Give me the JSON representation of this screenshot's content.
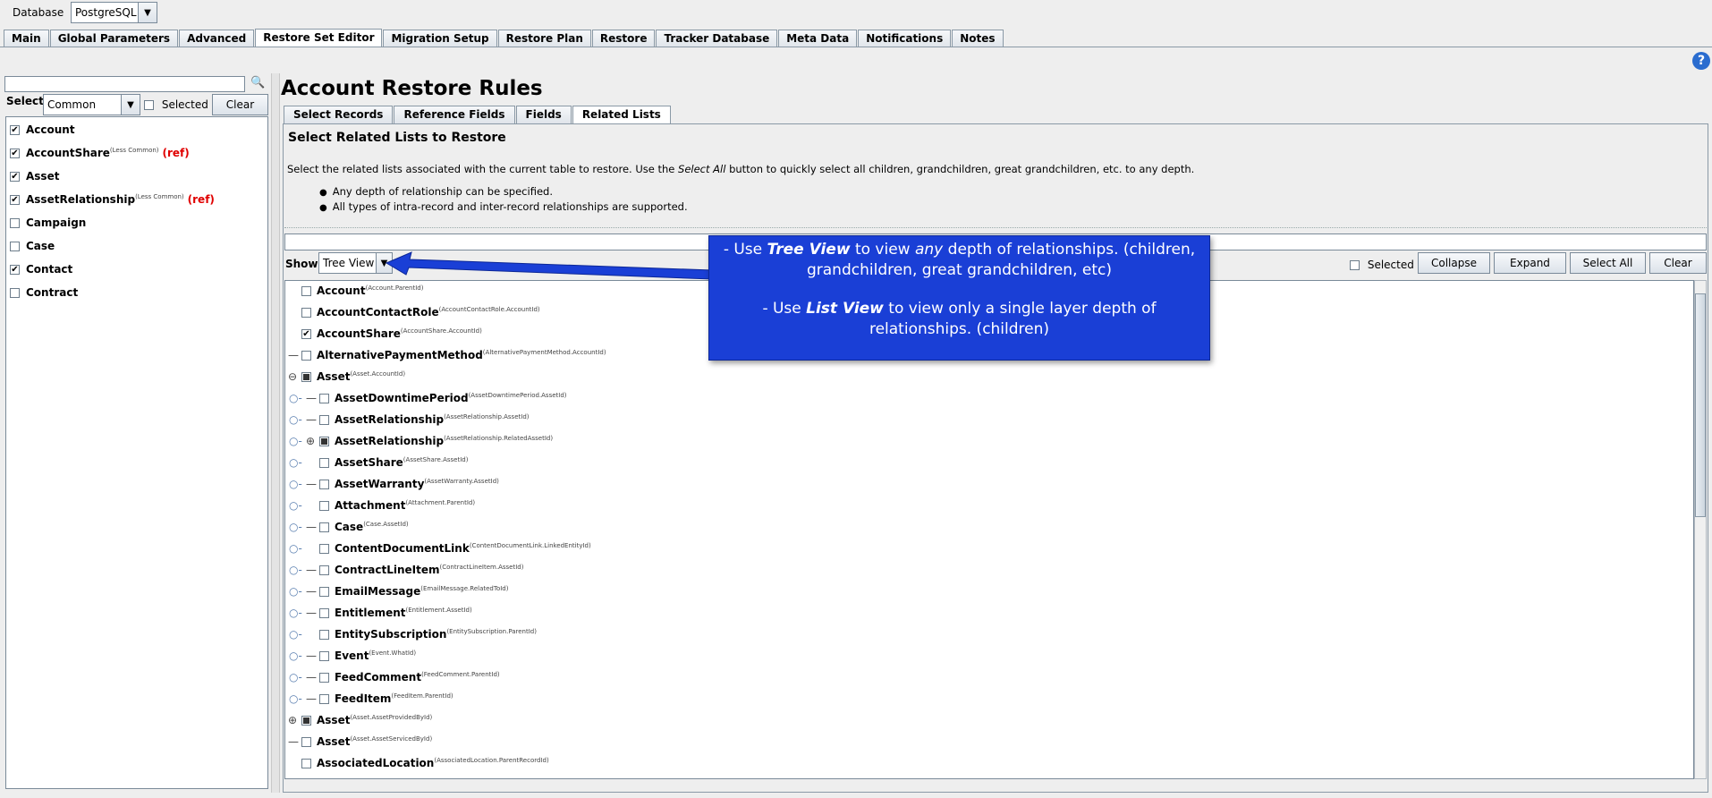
{
  "header": {
    "database_label": "Database",
    "database_value": "PostgreSQL"
  },
  "main_tabs": [
    "Main",
    "Global Parameters",
    "Advanced",
    "Restore Set Editor",
    "Migration Setup",
    "Restore Plan",
    "Restore",
    "Tracker Database",
    "Meta Data",
    "Notifications",
    "Notes"
  ],
  "left": {
    "select_label": "Select:",
    "select_value": "Common",
    "selected_label": "Selected",
    "clear_label": "Clear",
    "items": [
      {
        "label": "Account",
        "sup": "",
        "ref": "",
        "checked": true
      },
      {
        "label": "AccountShare",
        "sup": "(Less Common)",
        "ref": "(ref)",
        "checked": true
      },
      {
        "label": "Asset",
        "sup": "",
        "ref": "",
        "checked": true
      },
      {
        "label": "AssetRelationship",
        "sup": "(Less Common)",
        "ref": "(ref)",
        "checked": true
      },
      {
        "label": "Campaign",
        "sup": "",
        "ref": "",
        "checked": false
      },
      {
        "label": "Case",
        "sup": "",
        "ref": "",
        "checked": false
      },
      {
        "label": "Contact",
        "sup": "",
        "ref": "",
        "checked": true
      },
      {
        "label": "Contract",
        "sup": "",
        "ref": "",
        "checked": false
      }
    ]
  },
  "right": {
    "title": "Account Restore Rules",
    "sub_tabs": [
      "Select Records",
      "Reference Fields",
      "Fields",
      "Related Lists"
    ],
    "heading": "Select Related Lists to Restore",
    "desc_before": "Select the related lists associated with the current table to restore. Use the ",
    "desc_em": "Select All",
    "desc_after": " button to quickly select all children, grandchildren, great grandchildren, etc. to any depth.",
    "bullets": [
      "Any depth of relationship can be specified.",
      "All types of intra-record and inter-record relationships are supported."
    ],
    "show_label": "Show:",
    "show_value": "Tree View",
    "selected_label": "Selected",
    "collapse_label": "Collapse",
    "expand_label": "Expand",
    "select_all_label": "Select All",
    "clear_label": "Clear",
    "tree": [
      {
        "label": "Account",
        "sup": "(Account.ParentId)",
        "depth": 0,
        "state": "unchecked",
        "mark": ""
      },
      {
        "label": "AccountContactRole",
        "sup": "(AccountContactRole.AccountId)",
        "depth": 0,
        "state": "unchecked",
        "mark": ""
      },
      {
        "label": "AccountShare",
        "sup": "(AccountShare.AccountId)",
        "depth": 0,
        "state": "checked",
        "mark": ""
      },
      {
        "label": "AlternativePaymentMethod",
        "sup": "(AlternativePaymentMethod.AccountId)",
        "depth": 0,
        "state": "unchecked",
        "mark": "—"
      },
      {
        "label": "Asset",
        "sup": "(Asset.AccountId)",
        "depth": 0,
        "state": "partial",
        "mark": "⊖"
      },
      {
        "label": "AssetDowntimePeriod",
        "sup": "(AssetDowntimePeriod.AssetId)",
        "depth": 1,
        "state": "unchecked",
        "mark": "—"
      },
      {
        "label": "AssetRelationship",
        "sup": "(AssetRelationship.AssetId)",
        "depth": 1,
        "state": "unchecked",
        "mark": "—"
      },
      {
        "label": "AssetRelationship",
        "sup": "(AssetRelationship.RelatedAssetId)",
        "depth": 1,
        "state": "partial",
        "mark": "⊕"
      },
      {
        "label": "AssetShare",
        "sup": "(AssetShare.AssetId)",
        "depth": 1,
        "state": "unchecked",
        "mark": ""
      },
      {
        "label": "AssetWarranty",
        "sup": "(AssetWarranty.AssetId)",
        "depth": 1,
        "state": "unchecked",
        "mark": "—"
      },
      {
        "label": "Attachment",
        "sup": "(Attachment.ParentId)",
        "depth": 1,
        "state": "unchecked",
        "mark": ""
      },
      {
        "label": "Case",
        "sup": "(Case.AssetId)",
        "depth": 1,
        "state": "unchecked",
        "mark": "—"
      },
      {
        "label": "ContentDocumentLink",
        "sup": "(ContentDocumentLink.LinkedEntityId)",
        "depth": 1,
        "state": "unchecked",
        "mark": ""
      },
      {
        "label": "ContractLineItem",
        "sup": "(ContractLineItem.AssetId)",
        "depth": 1,
        "state": "unchecked",
        "mark": "—"
      },
      {
        "label": "EmailMessage",
        "sup": "(EmailMessage.RelatedToId)",
        "depth": 1,
        "state": "unchecked",
        "mark": "—"
      },
      {
        "label": "Entitlement",
        "sup": "(Entitlement.AssetId)",
        "depth": 1,
        "state": "unchecked",
        "mark": "—"
      },
      {
        "label": "EntitySubscription",
        "sup": "(EntitySubscription.ParentId)",
        "depth": 1,
        "state": "unchecked",
        "mark": ""
      },
      {
        "label": "Event",
        "sup": "(Event.WhatId)",
        "depth": 1,
        "state": "unchecked",
        "mark": "—"
      },
      {
        "label": "FeedComment",
        "sup": "(FeedComment.ParentId)",
        "depth": 1,
        "state": "unchecked",
        "mark": "—"
      },
      {
        "label": "FeedItem",
        "sup": "(FeedItem.ParentId)",
        "depth": 1,
        "state": "unchecked",
        "mark": "—"
      },
      {
        "label": "Asset",
        "sup": "(Asset.AssetProvidedById)",
        "depth": 0,
        "state": "partial",
        "mark": "⊕"
      },
      {
        "label": "Asset",
        "sup": "(Asset.AssetServicedById)",
        "depth": 0,
        "state": "unchecked",
        "mark": "—"
      },
      {
        "label": "AssociatedLocation",
        "sup": "(AssociatedLocation.ParentRecordId)",
        "depth": 0,
        "state": "unchecked",
        "mark": ""
      }
    ]
  },
  "callout": {
    "line1_pre": "- Use ",
    "line1_bold": "Tree View",
    "line1_mid": " to view ",
    "line1_em": "any",
    "line1_post": " depth of relationships. (children, grandchildren, great grandchildren, etc)",
    "line2_pre": "- Use ",
    "line2_bold": "List View",
    "line2_post": " to view only a single layer depth of relationships. (children)"
  },
  "colors": {
    "callout_bg": "#1a3fd6",
    "ref": "#e00000",
    "help": "#2a6ccf"
  }
}
